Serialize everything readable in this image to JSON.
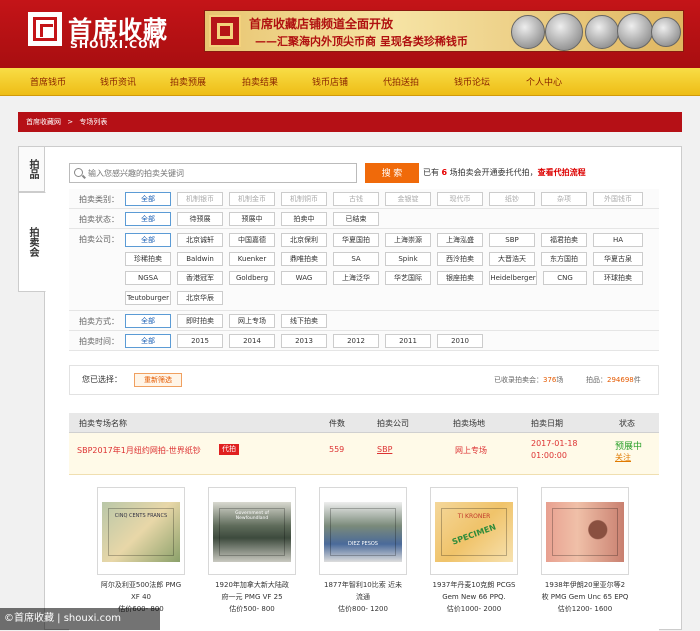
{
  "header": {
    "logo_cn": "首席收藏",
    "logo_en": "SHOUXI.COM",
    "banner_line1": "首席收藏店铺频道全面开放",
    "banner_line2": "——汇聚海内外顶尖币商  呈现各类珍稀钱币"
  },
  "nav": [
    "首席钱币",
    "钱币资讯",
    "拍卖预展",
    "拍卖结果",
    "钱币店铺",
    "代拍送拍",
    "钱币论坛",
    "个人中心"
  ],
  "breadcrumb": [
    "首席收藏网",
    ">",
    "专场列表"
  ],
  "side_tabs": [
    "拍品",
    "拍卖会"
  ],
  "search": {
    "placeholder": "输入您感兴趣的拍卖关键词",
    "button": "搜 索",
    "count_prefix": "已有",
    "count": "6",
    "count_suffix": "场拍卖会开通委托代拍，",
    "process_link": "查看代拍流程"
  },
  "filters": {
    "category": {
      "label": "拍卖类别：",
      "options": [
        "全部",
        "机制银币",
        "机制金币",
        "机制铜币",
        "古钱",
        "金银锭",
        "现代币",
        "纸钞",
        "杂项",
        "外国钱币"
      ]
    },
    "status": {
      "label": "拍卖状态：",
      "options": [
        "全部",
        "待预展",
        "预展中",
        "拍卖中",
        "已结束"
      ]
    },
    "company": {
      "label": "拍卖公司：",
      "options": [
        "全部",
        "北京诚轩",
        "中国嘉德",
        "北京保利",
        "华夏国拍",
        "上海崇源",
        "上海泓盛",
        "SBP",
        "福君拍卖",
        "HA",
        "珍稀拍卖",
        "Baldwin",
        "Kuenker",
        "鼎唯拍卖",
        "SA",
        "Spink",
        "西泠拍卖",
        "大晋浩天",
        "东方国拍",
        "华夏古泉",
        "NGSA",
        "香港冠军",
        "Goldberg",
        "WAG",
        "上海泛华",
        "华艺国际",
        "银座拍卖",
        "Heidelberger",
        "CNG",
        "环球拍卖",
        "Teutoburger",
        "北京华辰"
      ]
    },
    "method": {
      "label": "拍卖方式：",
      "options": [
        "全部",
        "即时拍卖",
        "网上专场",
        "线下拍卖"
      ]
    },
    "time": {
      "label": "拍卖时间：",
      "options": [
        "全部",
        "2015",
        "2014",
        "2013",
        "2012",
        "2011",
        "2010"
      ]
    }
  },
  "selected": {
    "label": "您已选择：",
    "reset": "重新筛选",
    "recorded_label": "已收录拍卖会：",
    "recorded_count": "376",
    "recorded_unit": "场",
    "lots_label": "拍品：",
    "lots_count": "294698",
    "lots_unit": "件"
  },
  "table": {
    "headers": [
      "拍卖专场名称",
      "件数",
      "拍卖公司",
      "拍卖场地",
      "拍卖日期",
      "状态"
    ],
    "row": {
      "title": "SBP2017年1月纽约网拍-世界纸钞",
      "tag": "代拍",
      "count": "559",
      "company": "SBP",
      "venue": "网上专场",
      "date_line1": "2017-01-18",
      "date_line2": "01:00:00",
      "status": "预展中",
      "follow": "关注"
    }
  },
  "lots": [
    {
      "line1": "阿尔及利亚500法郎 PMG",
      "line2": "XF 40",
      "line3": "估价600- 800"
    },
    {
      "line1": "1920年加拿大新大陆政",
      "line2": "府一元 PMG VF 25",
      "line3": "估价500- 800"
    },
    {
      "line1": "1877年智利10比索 近未",
      "line2": "流通",
      "line3": "估价800- 1200"
    },
    {
      "line1": "1937年丹麦10克朗 PCGS",
      "line2": "Gem New 66 PPQ.",
      "line3": "估价1000- 2000"
    },
    {
      "line1": "1938年伊朗20里亚尔等2",
      "line2": "枚 PMG Gem Unc 65 EPQ",
      "line3": "估价1200- 1600"
    }
  ],
  "note_texts": [
    "CINQ CENTS FRANCS",
    "Government of Newfoundland",
    "DIEZ PESOS",
    "TI KRONER",
    "SPECIMEN"
  ],
  "watermark": "©首席收藏 | shouxi.com"
}
